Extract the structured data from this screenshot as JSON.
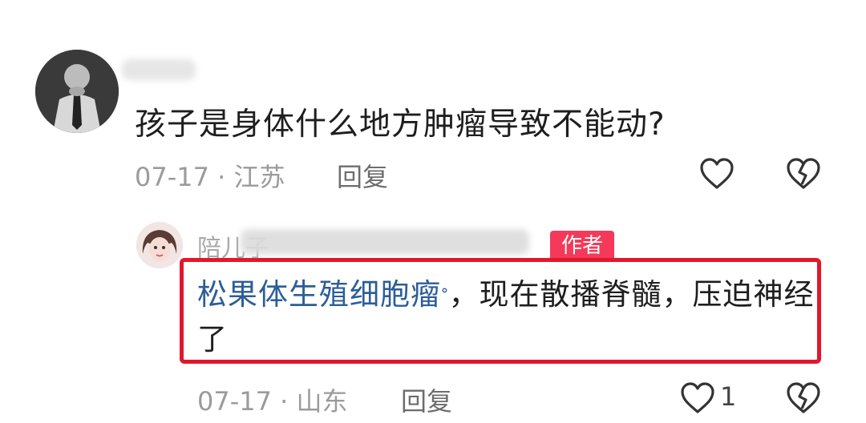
{
  "comment": {
    "text": "孩子是身体什么地方肿瘤导致不能动?",
    "date": "07-17",
    "location": "江苏",
    "reply_label": "回复"
  },
  "reply": {
    "author_name": "陪儿子",
    "author_tag": "作者",
    "link_text": "松果体生殖细胞瘤",
    "search_mark": "ᐤ",
    "text_after_link": "，现在散播脊髓，压迫神经了",
    "date": "07-17",
    "location": "山东",
    "reply_label": "回复",
    "like_count": "1"
  },
  "colors": {
    "highlight_border": "#e3172b",
    "author_tag": "#f4395a",
    "link": "#2c5d98"
  },
  "icons": [
    "heart-outline",
    "broken-heart"
  ]
}
